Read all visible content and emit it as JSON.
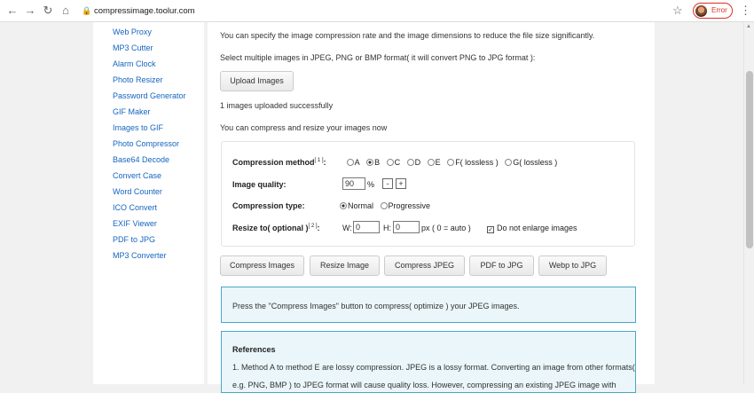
{
  "browser": {
    "url": "compressimage.toolur.com",
    "profile_status": "Error"
  },
  "sidebar": {
    "items": [
      "Web Proxy",
      "MP3 Cutter",
      "Alarm Clock",
      "Photo Resizer",
      "Password Generator",
      "GIF Maker",
      "Images to GIF",
      "Photo Compressor",
      "Base64 Decode",
      "Convert Case",
      "Word Counter",
      "ICO Convert",
      "EXIF Viewer",
      "PDF to JPG",
      "MP3 Converter"
    ]
  },
  "main": {
    "intro": "You can specify the image compression rate and the image dimensions to reduce the file size significantly.",
    "select_text": "Select multiple images in JPEG, PNG or BMP format( it will convert PNG to JPG format ):",
    "upload_button": "Upload Images",
    "upload_status": "1 images uploaded successfully",
    "compress_now": "You can compress and resize your images now",
    "settings": {
      "method_label": "Compression method",
      "method_sup": "[ 1 ]",
      "method_options": [
        "A",
        "B",
        "C",
        "D",
        "E",
        "F( lossless )",
        "G( lossless )"
      ],
      "method_selected": "B",
      "quality_label": "Image quality:",
      "quality_value": "90",
      "quality_unit": "%",
      "quality_minus": "-",
      "quality_plus": "+",
      "type_label": "Compression type:",
      "type_options": [
        "Normal",
        "Progressive"
      ],
      "type_selected": "Normal",
      "resize_label": "Resize to( optional )",
      "resize_sup": "[ 2 ]",
      "resize_colon": ":",
      "w_label": "W:",
      "w_value": "0",
      "h_label": "H:",
      "h_value": "0",
      "px_note": "px ( 0 = auto )",
      "no_enlarge": "Do not enlarge images",
      "no_enlarge_checked": true
    },
    "actions": [
      "Compress Images",
      "Resize Image",
      "Compress JPEG",
      "PDF to JPG",
      "Webp to JPG"
    ],
    "info_text": "Press the \"Compress Images\" button to compress( optimize ) your JPEG images.",
    "references_title": "References",
    "references_text": "1. Method A to method E are lossy compression. JPEG is a lossy format. Converting an image from other formats(",
    "references_text2": "e.g. PNG, BMP ) to JPEG format will cause quality loss. However, compressing an existing JPEG image with"
  }
}
